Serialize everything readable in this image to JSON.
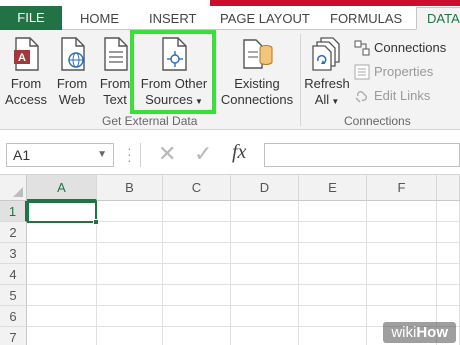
{
  "tabs": [
    "FILE",
    "HOME",
    "INSERT",
    "PAGE LAYOUT",
    "FORMULAS",
    "DATA"
  ],
  "ribbon": {
    "get_external_data": {
      "from_access": [
        "From",
        "Access"
      ],
      "from_web": [
        "From",
        "Web"
      ],
      "from_text": [
        "From",
        "Text"
      ],
      "from_other_sources": [
        "From Other",
        "Sources"
      ],
      "existing_connections": [
        "Existing",
        "Connections"
      ],
      "group_label": "Get External Data"
    },
    "connections": {
      "refresh_all": [
        "Refresh",
        "All"
      ],
      "connections": "Connections",
      "properties": "Properties",
      "edit_links": "Edit Links",
      "group_label": "Connections"
    }
  },
  "formula_bar": {
    "name_box": "A1",
    "fx": "fx",
    "value": ""
  },
  "grid": {
    "columns": [
      "A",
      "B",
      "C",
      "D",
      "E",
      "F"
    ],
    "rows": [
      "1",
      "2",
      "3",
      "4",
      "5",
      "6",
      "7"
    ],
    "selected_cell": "A1"
  },
  "watermark": {
    "wiki": "wiki",
    "how": "How"
  },
  "colors": {
    "excel_green": "#217346",
    "highlight": "#38e038",
    "accent_red": "#c8102e"
  }
}
